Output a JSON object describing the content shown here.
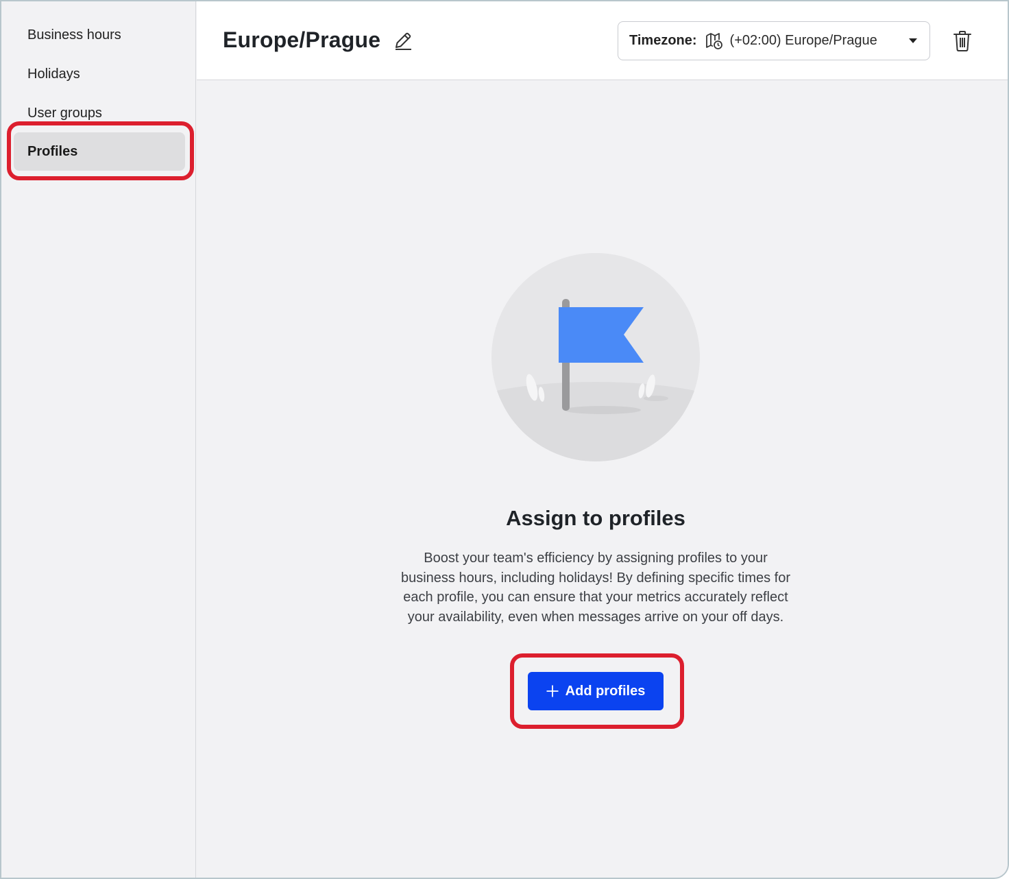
{
  "sidebar": {
    "items": [
      {
        "label": "Business hours",
        "active": false
      },
      {
        "label": "Holidays",
        "active": false
      },
      {
        "label": "User groups",
        "active": false
      },
      {
        "label": "Profiles",
        "active": true
      }
    ]
  },
  "header": {
    "title": "Europe/Prague",
    "timezone": {
      "label": "Timezone:",
      "value": "(+02:00) Europe/Prague"
    }
  },
  "empty_state": {
    "title": "Assign to profiles",
    "description": "Boost your team's efficiency by assigning profiles to your business hours, including holidays! By defining specific times for each profile, you can ensure that your metrics accurately reflect your availability, even when messages arrive on your off days.",
    "button_label": "Add profiles"
  },
  "colors": {
    "accent": "#0b43f0",
    "highlight": "#dc1f2e",
    "flag": "#4a8af7"
  },
  "icons": [
    "edit-pencil-icon",
    "map-clock-icon",
    "chevron-down-icon",
    "trash-icon",
    "plus-icon",
    "flag-illustration"
  ]
}
